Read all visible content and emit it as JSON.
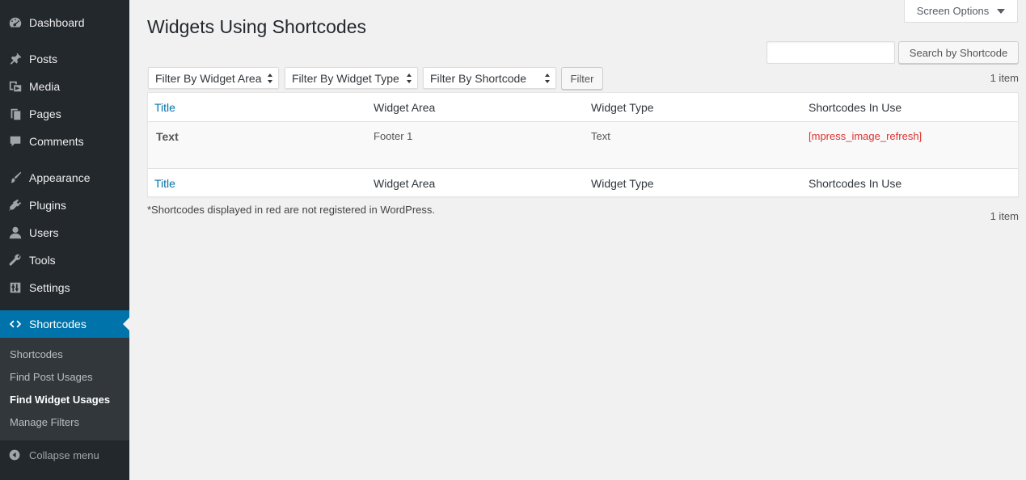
{
  "sidebar": {
    "items": [
      {
        "label": "Dashboard",
        "icon": "dashboard-icon"
      },
      {
        "label": "Posts",
        "icon": "pin-icon"
      },
      {
        "label": "Media",
        "icon": "media-icon"
      },
      {
        "label": "Pages",
        "icon": "pages-icon"
      },
      {
        "label": "Comments",
        "icon": "comment-icon"
      },
      {
        "label": "Appearance",
        "icon": "paintbrush-icon"
      },
      {
        "label": "Plugins",
        "icon": "plugin-icon"
      },
      {
        "label": "Users",
        "icon": "user-icon"
      },
      {
        "label": "Tools",
        "icon": "wrench-icon"
      },
      {
        "label": "Settings",
        "icon": "settings-icon"
      },
      {
        "label": "Shortcodes",
        "icon": "code-brackets-icon",
        "active": true
      }
    ],
    "submenu": [
      {
        "label": "Shortcodes"
      },
      {
        "label": "Find Post Usages"
      },
      {
        "label": "Find Widget Usages",
        "current": true
      },
      {
        "label": "Manage Filters"
      }
    ],
    "collapse_label": "Collapse menu"
  },
  "header": {
    "screen_options_label": "Screen Options",
    "title": "Widgets Using Shortcodes"
  },
  "search": {
    "value": "",
    "button_label": "Search by Shortcode"
  },
  "filters": {
    "widget_area": "Filter By Widget Area",
    "widget_type": "Filter By Widget Type",
    "shortcode": "Filter By Shortcode",
    "button_label": "Filter"
  },
  "items_count": "1 item",
  "table": {
    "columns": [
      "Title",
      "Widget Area",
      "Widget Type",
      "Shortcodes In Use"
    ],
    "rows": [
      {
        "title": "Text",
        "widget_area": "Footer 1",
        "widget_type": "Text",
        "shortcodes": "[mpress_image_refresh]"
      }
    ]
  },
  "footnote": "*Shortcodes displayed in red are not registered in WordPress.",
  "colors": {
    "sidebar_bg": "#23282d",
    "submenu_bg": "#32373c",
    "accent": "#0073aa",
    "unregistered_shortcode": "#dc3232"
  }
}
